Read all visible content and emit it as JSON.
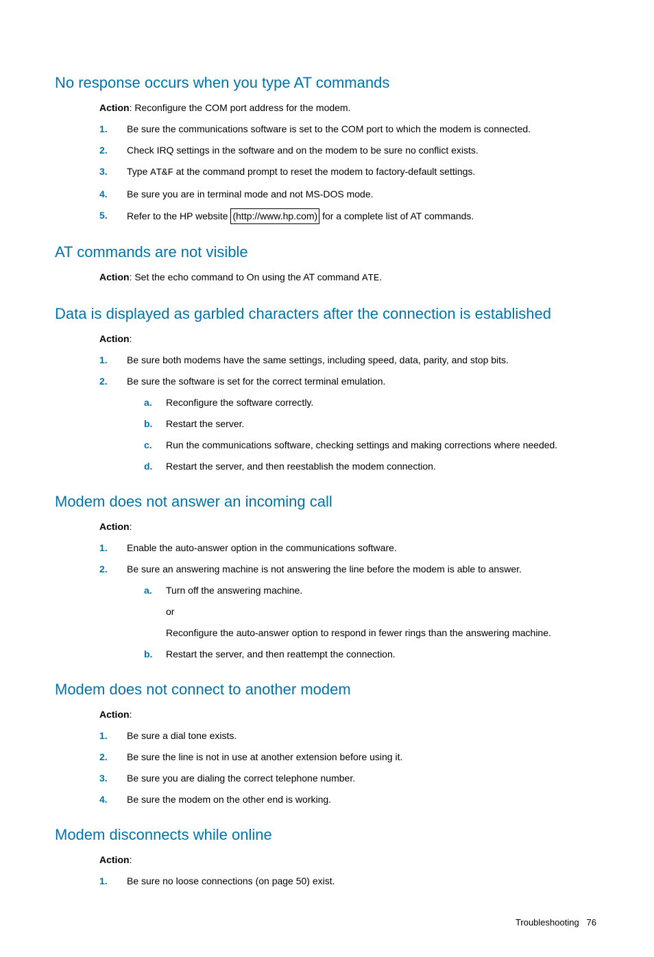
{
  "sections": [
    {
      "heading": "No response occurs when you type AT commands",
      "action_prefix": "Action",
      "action_text": ": Reconfigure the COM port address for the modem.",
      "items": [
        {
          "num": "1.",
          "text": "Be sure the communications software is set to the COM port to which the modem is connected."
        },
        {
          "num": "2.",
          "text": "Check IRQ settings in the software and on the modem to be sure no conflict exists."
        },
        {
          "num": "3.",
          "pre": "Type ",
          "mono": "AT&F",
          "post": " at the command prompt to reset the modem to factory-default settings."
        },
        {
          "num": "4.",
          "text": "Be sure you are in terminal mode and not MS-DOS mode."
        },
        {
          "num": "5.",
          "pre": "Refer to the HP website ",
          "link": "(http://www.hp.com)",
          "post": " for a complete list of AT commands."
        }
      ]
    },
    {
      "heading": "AT commands are not visible",
      "action_prefix": "Action",
      "action_pre": ": Set the echo command to On using the AT command ",
      "action_mono": "ATE",
      "action_post": "."
    },
    {
      "heading": "Data is displayed as garbled characters after the connection is established",
      "action_prefix": "Action",
      "action_text": ":",
      "items": [
        {
          "num": "1.",
          "text": "Be sure both modems have the same settings, including speed, data, parity, and stop bits."
        },
        {
          "num": "2.",
          "text": "Be sure the software is set for the correct terminal emulation.",
          "sub": [
            {
              "letter": "a.",
              "text": "Reconfigure the software correctly."
            },
            {
              "letter": "b.",
              "text": "Restart the server."
            },
            {
              "letter": "c.",
              "text": "Run the communications software, checking settings and making corrections where needed."
            },
            {
              "letter": "d.",
              "text": "Restart the server, and then reestablish the modem connection."
            }
          ]
        }
      ]
    },
    {
      "heading": "Modem does not answer an incoming call",
      "action_prefix": "Action",
      "action_text": ":",
      "items": [
        {
          "num": "1.",
          "text": "Enable the auto-answer option in the communications software."
        },
        {
          "num": "2.",
          "text": "Be sure an answering machine is not answering the line before the modem is able to answer.",
          "sub": [
            {
              "letter": "a.",
              "text": "Turn off the answering machine.",
              "extra1": "or",
              "extra2": "Reconfigure the auto-answer option to respond in fewer rings than the answering machine."
            },
            {
              "letter": "b.",
              "text": "Restart the server, and then reattempt the connection."
            }
          ]
        }
      ]
    },
    {
      "heading": "Modem does not connect to another modem",
      "action_prefix": "Action",
      "action_text": ":",
      "items": [
        {
          "num": "1.",
          "text": "Be sure a dial tone exists."
        },
        {
          "num": "2.",
          "text": "Be sure the line is not in use at another extension before using it."
        },
        {
          "num": "3.",
          "text": "Be sure you are dialing the correct telephone number."
        },
        {
          "num": "4.",
          "text": "Be sure the modem on the other end is working."
        }
      ]
    },
    {
      "heading": "Modem disconnects while online",
      "action_prefix": "Action",
      "action_text": ":",
      "items": [
        {
          "num": "1.",
          "text": "Be sure no loose connections (on page 50) exist."
        }
      ]
    }
  ],
  "footer": {
    "section": "Troubleshooting",
    "page": "76"
  }
}
